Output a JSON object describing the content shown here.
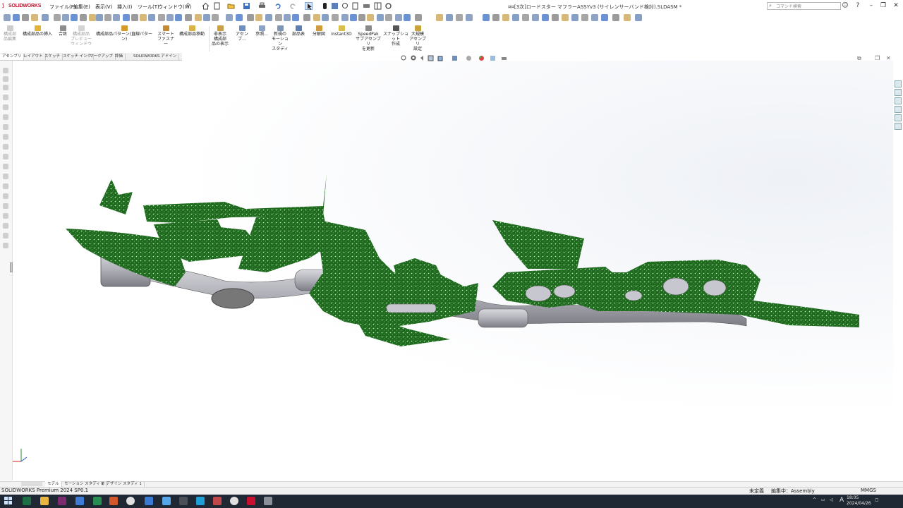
{
  "app": {
    "logo_text": "SOLIDWORKS",
    "document_title": "¤¤[3次]ロードスター マフラーASSYv3 (サイレンサーバンド検討).SLDASM *",
    "search_placeholder": "コマンド検索",
    "colors": {
      "brand": "#c8102e",
      "mesh": "#1e6b1e",
      "pipe": "#b4b4bc",
      "taskbar": "#202833"
    }
  },
  "menu": [
    "ファイル(F)",
    "編集(E)",
    "表示(V)",
    "挿入(I)",
    "ツール(T)",
    "ウィンドウ(W)"
  ],
  "command_manager": [
    {
      "label": "構成部\n品編集",
      "disabled": true
    },
    {
      "label": "構成部品の挿入",
      "disabled": false
    },
    {
      "label": "合致",
      "disabled": false
    },
    {
      "label": "構成部品\nプレビュー\nウィンドウ",
      "disabled": true
    },
    {
      "label": "構成部品パターン(直線パターン)",
      "disabled": false
    },
    {
      "label": "スマート\nファスナー",
      "disabled": false
    },
    {
      "label": "構成部品移動",
      "disabled": false
    },
    {
      "label": "非表示\n構成部\n品の表示",
      "disabled": false
    },
    {
      "label": "アセンブ...",
      "disabled": false
    },
    {
      "label": "参照...",
      "disabled": false
    },
    {
      "label": "新規の\nモーション\nスタディ",
      "disabled": false
    },
    {
      "label": "部品表",
      "disabled": false
    },
    {
      "label": "分解図",
      "disabled": false
    },
    {
      "label": "Instant3D",
      "disabled": false
    },
    {
      "label": "SpeedPak\nサブアセンブリ\nを更新",
      "disabled": false
    },
    {
      "label": "スナップショット\n作成",
      "disabled": false
    },
    {
      "label": "大規模\nアセンブリ\n設定",
      "disabled": false
    }
  ],
  "tabs": [
    "アセンブリ",
    "レイアウト",
    "スケッチ",
    "スケッチ インク",
    "マークアップ",
    "評価",
    "SOLIDWORKS アドイン"
  ],
  "bottom_tabs": [
    "モデル",
    "モーション スタディ 1",
    "Ⓜ デザイン スタディ 1"
  ],
  "status": {
    "product": "SOLIDWORKS Premium 2024 SP0.1",
    "definition": "未定義",
    "editing": "編集中：Assembly",
    "units": "MMGS"
  },
  "taskbar": {
    "time": "18:05",
    "date": "2024/04/26",
    "lang": "A"
  }
}
